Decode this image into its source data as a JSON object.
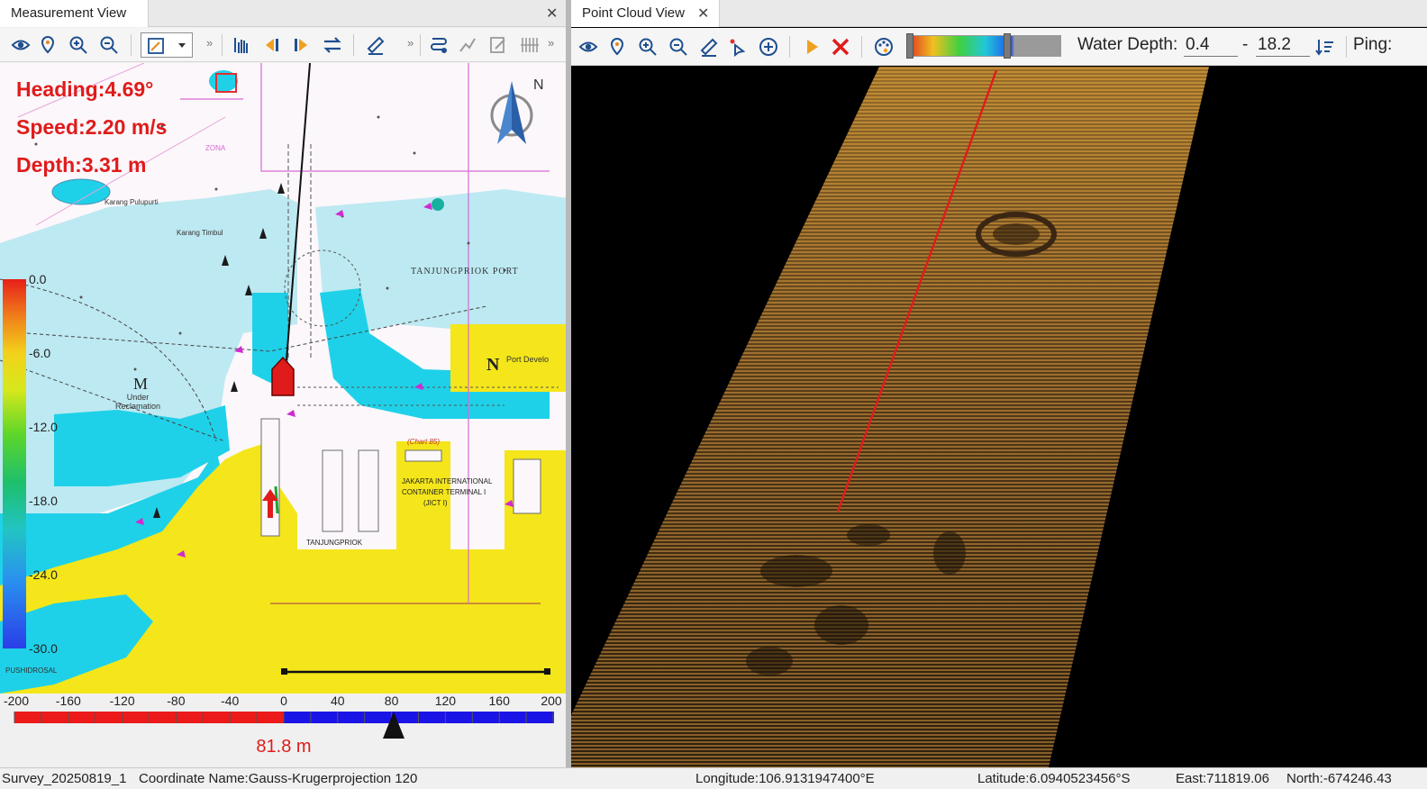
{
  "left": {
    "tab_title": "Measurement View",
    "tab_close": "✕",
    "toolbar_more": "»",
    "hud": {
      "heading": "Heading:4.69°",
      "speed": "Speed:2.20 m/s",
      "depth": "Depth:3.31 m"
    },
    "compass_label": "N",
    "legend": [
      "0.0",
      "-6.0",
      "-12.0",
      "-18.0",
      "-24.0",
      "-30.0"
    ],
    "map_labels": {
      "tanjungpriok_port": "TANJUNGPRIOK PORT",
      "area_n": "N",
      "port_develop": "Port Develo",
      "area_m": "M",
      "under_reclamation": "Under Reclamation",
      "jict_line1": "JAKARTA INTERNATIONAL",
      "jict_line2": "CONTAINER TERMINAL I",
      "jict_line3": "(JICT I)",
      "tanjungpriok": "TANJUNGPRIOK",
      "karang_pulupurti": "Karang Pulupurti",
      "karang_timbul": "Karang Timbul",
      "chart_ref": "(Chart 85)",
      "zona": "ZONA",
      "pushidrosal": "PUSHIDROSAL"
    },
    "scale": {
      "ticks": [
        "-200",
        "-160",
        "-120",
        "-80",
        "-40",
        "0",
        "40",
        "80",
        "120",
        "160",
        "200"
      ],
      "offset_value": "81.8 m",
      "offset_fraction": 0.704
    }
  },
  "right": {
    "tab_title": "Point Cloud View",
    "tab_close": "✕",
    "water_depth_label": "Water Depth:",
    "depth_min": "0.4",
    "depth_separator": "-",
    "depth_max": "18.2",
    "ping_label": "Ping:"
  },
  "status": {
    "survey": "Survey_20250819_1",
    "coordinate": "Coordinate Name:Gauss-Krugerprojection 120",
    "longitude": "Longitude:106.9131947400°E",
    "latitude": "Latitude:6.0940523456°S",
    "east": "East:711819.06",
    "north": "North:-674246.43"
  },
  "colors": {
    "hud_red": "#e01b1b",
    "sea_cyan": "#1fd1e8",
    "land_yellow": "#f4e61a",
    "shallow_blue": "#bde9f2",
    "point_cloud": "#e0a040"
  }
}
